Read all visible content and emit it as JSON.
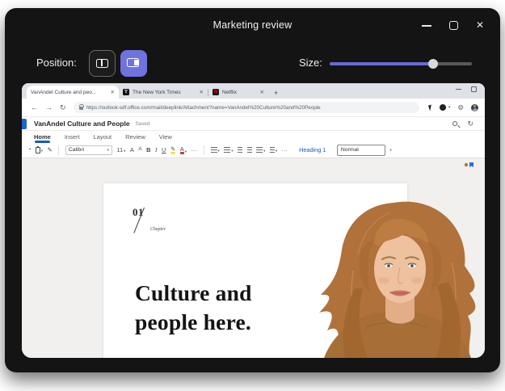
{
  "window": {
    "title": "Marketing review"
  },
  "toolbar": {
    "position_label": "Position:",
    "size_label": "Size:",
    "size_percent": 73
  },
  "browser": {
    "tabs": [
      {
        "title": "VanAndel Culture and peo..."
      },
      {
        "title": "The New York Times",
        "favicon": "T"
      },
      {
        "title": "Netflix",
        "favicon": "N"
      }
    ],
    "url": "https://outlook-sdf.office.com/mail/deeplink/Attachment?name=VanAndel%20Culture%20and%20People"
  },
  "word": {
    "doc_title": "VanAndel Culture and People",
    "saved": "Saved",
    "ribbon_tabs": [
      "Home",
      "Insert",
      "Layout",
      "Review",
      "View"
    ],
    "font_name": "Calibri",
    "font_size": "11",
    "style_link": "Heading 1",
    "style_selected": "Normal"
  },
  "document": {
    "chapter_number": "01",
    "chapter_label": "Chapter",
    "heading_lines": [
      "Culture and",
      "people here."
    ]
  },
  "glyphs": {
    "close": "✕",
    "plus": "+",
    "back": "←",
    "forward": "→",
    "refresh": "↻",
    "caret": "▾",
    "more": "…",
    "bold": "B",
    "italic": "I",
    "underline": "U",
    "grow_font": "A",
    "shrink_font": "A",
    "font_color": "A",
    "painter": "✎",
    "gear": "⚙",
    "undo": "↻"
  },
  "colors": {
    "accent_purple": "#6e73de",
    "word_accent": "#185abd",
    "slider_fill": "#666bd6"
  }
}
